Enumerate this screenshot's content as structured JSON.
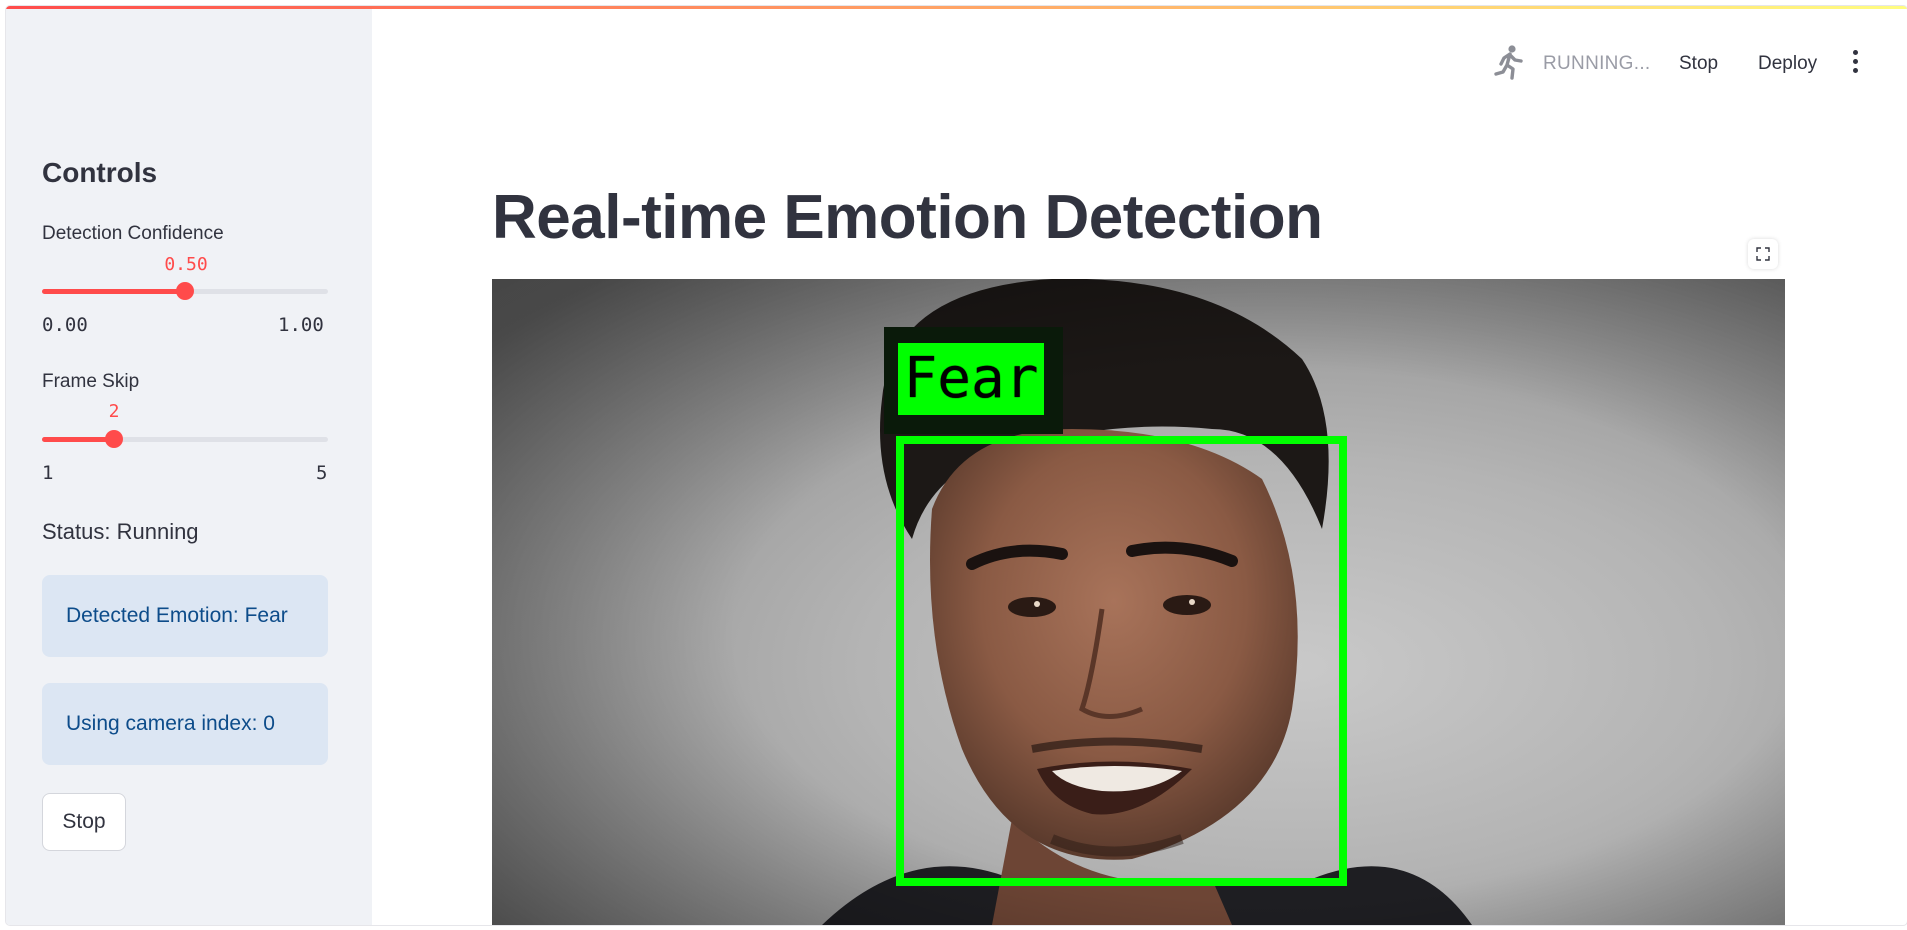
{
  "header": {
    "running_label": "RUNNING...",
    "stop_label": "Stop",
    "deploy_label": "Deploy",
    "running_icon": "running-man-icon",
    "menu_icon": "kebab-menu-icon"
  },
  "sidebar": {
    "title": "Controls",
    "confidence": {
      "label": "Detection Confidence",
      "value_text": "0.50",
      "value": 0.5,
      "min_text": "0.00",
      "max_text": "1.00"
    },
    "frame_skip": {
      "label": "Frame Skip",
      "value_text": "2",
      "value": 2,
      "min_text": "1",
      "max_text": "5"
    },
    "status": "Status: Running",
    "detected_emotion": "Detected Emotion: Fear",
    "camera_index": "Using camera index: 0",
    "stop_label": "Stop"
  },
  "main": {
    "title": "Real-time Emotion Detection",
    "fullscreen_icon": "expand-icon",
    "detection_label": "Fear"
  },
  "colors": {
    "accent": "#ff4b4b",
    "info_bg": "#dce6f3",
    "info_text": "#0d4c8a",
    "box": "#00ff00"
  }
}
